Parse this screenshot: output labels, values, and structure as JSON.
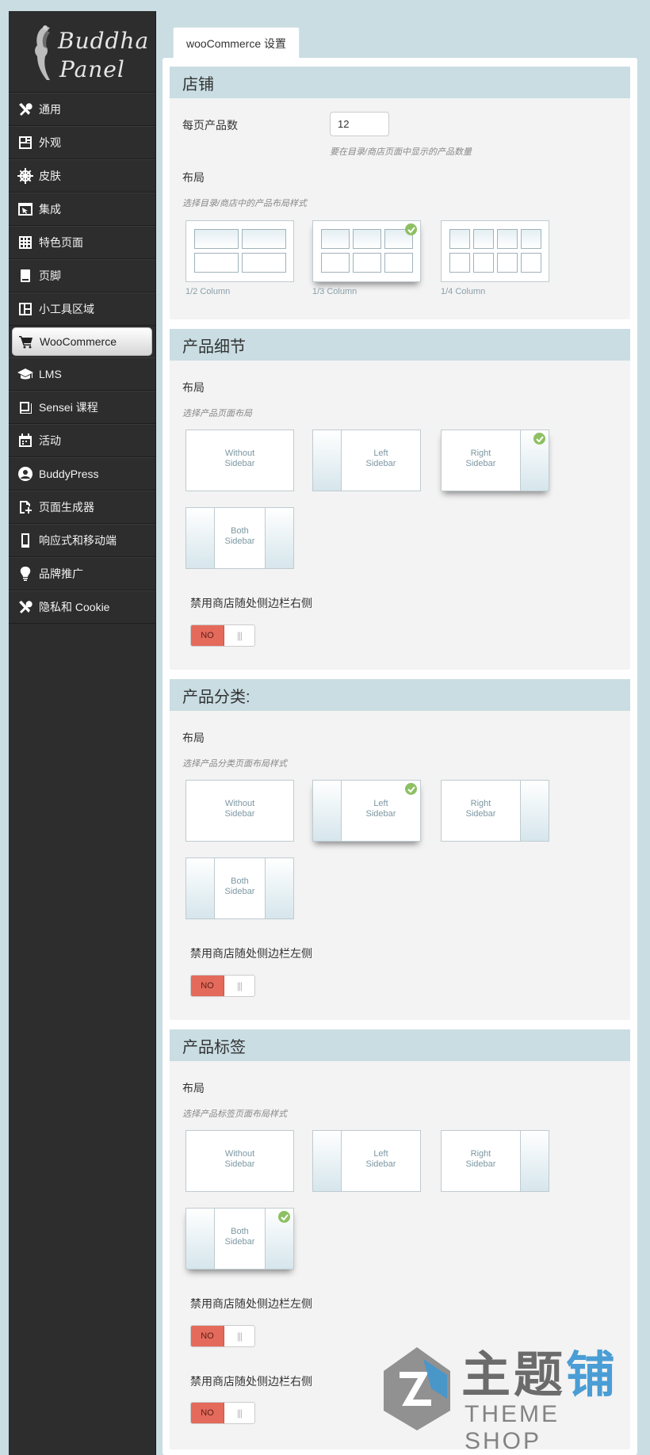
{
  "logo": {
    "line1": "Buddha",
    "line2": "Panel"
  },
  "sidebar": {
    "items": [
      {
        "label": "通用",
        "icon": "wrench-icon"
      },
      {
        "label": "外观",
        "icon": "layout-icon"
      },
      {
        "label": "皮肤",
        "icon": "ship-wheel-icon"
      },
      {
        "label": "集成",
        "icon": "window-icon"
      },
      {
        "label": "特色页面",
        "icon": "grid-icon"
      },
      {
        "label": "页脚",
        "icon": "footer-icon"
      },
      {
        "label": "小工具区域",
        "icon": "widgets-icon"
      },
      {
        "label": "WooCommerce",
        "icon": "cart-icon",
        "active": true
      },
      {
        "label": "LMS",
        "icon": "graduation-cap-icon"
      },
      {
        "label": "Sensei 课程",
        "icon": "book-icon"
      },
      {
        "label": "活动",
        "icon": "calendar-icon"
      },
      {
        "label": "BuddyPress",
        "icon": "buddypress-icon"
      },
      {
        "label": "页面生成器",
        "icon": "page-builder-icon"
      },
      {
        "label": "响应式和移动端",
        "icon": "mobile-icon"
      },
      {
        "label": "品牌推广",
        "icon": "lightbulb-icon"
      },
      {
        "label": "隐私和 Cookie",
        "icon": "tools-icon"
      }
    ]
  },
  "tab": {
    "label": "wooCommerce 设置"
  },
  "shop": {
    "title": "店铺",
    "per_page_label": "每页产品数",
    "per_page_value": "12",
    "per_page_hint": "要在目录/商店页面中显示的产品数量",
    "layout_label": "布局",
    "layout_hint": "选择目录/商店中的产品布局样式",
    "columns": [
      "1/2 Column",
      "1/3 Column",
      "1/4 Column"
    ],
    "selected_column": "1/3 Column"
  },
  "detail": {
    "title": "产品细节",
    "layout_label": "布局",
    "layout_hint": "选择产品页面布局",
    "options": [
      "Without Sidebar",
      "Left Sidebar",
      "Right Sidebar",
      "Both Sidebar"
    ],
    "selected": "Right Sidebar",
    "toggle_label": "禁用商店随处侧边栏右侧",
    "toggle_value": "NO"
  },
  "category": {
    "title": "产品分类:",
    "layout_label": "布局",
    "layout_hint": "选择产品分类页面布局样式",
    "selected": "Left Sidebar",
    "toggle_label": "禁用商店随处侧边栏左侧",
    "toggle_value": "NO"
  },
  "tag": {
    "title": "产品标签",
    "layout_label": "布局",
    "layout_hint": "选择产品标签页面布局样式",
    "selected": "Both Sidebar",
    "toggle1_label": "禁用商店随处侧边栏左侧",
    "toggle1_value": "NO",
    "toggle2_label": "禁用商店随处侧边栏右侧",
    "toggle2_value": "NO"
  },
  "layout_text": {
    "without": [
      "Without",
      "Sidebar"
    ],
    "left": [
      "Left",
      "Sidebar"
    ],
    "right": [
      "Right",
      "Sidebar"
    ],
    "both": [
      "Both",
      "Sidebar"
    ]
  },
  "watermark": {
    "cn_a": "主题",
    "cn_b": "铺",
    "en": "THEME SHOP"
  },
  "colors": {
    "background": "#c9dde3",
    "sidebar": "#2d2d2d",
    "section_head": "#c9dde3",
    "toggle_no": "#e46a5b",
    "check": "#8dc063"
  }
}
